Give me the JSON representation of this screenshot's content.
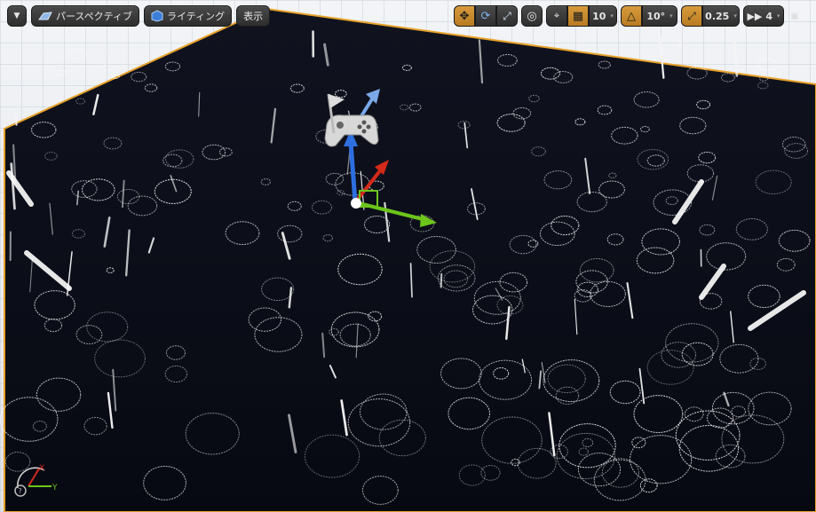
{
  "viewport": {
    "menu_icon": "chevron-down-icon",
    "perspective_label": "パースペクティブ",
    "perspective_icon": "perspective-icon",
    "lighting_label": "ライティング",
    "lighting_icon": "lighting-icon",
    "show_label": "表示"
  },
  "transform_tools": {
    "translate_icon": "translate-icon",
    "rotate_icon": "rotate-icon",
    "scale_icon": "scale-icon",
    "world_local_icon": "globe-icon",
    "surface_snap_icon": "surface-snap-icon",
    "grid_snap_icon": "grid-snap-icon",
    "grid_snap_value": "10",
    "rotation_snap_icon": "rotation-snap-icon",
    "rotation_snap_value": "10°",
    "scale_snap_icon": "scale-snap-icon",
    "scale_snap_value": "0.25",
    "camera_speed_icon": "camera-speed-icon",
    "camera_speed_value": "4",
    "maximize_icon": "maximize-icon"
  },
  "axis_labels": {
    "x": "X",
    "y": "Y"
  },
  "colors": {
    "selection_outline": "#e8a22a",
    "floor": "#0b0e1c",
    "active_button": "#c88a2e",
    "axis_x": "#d42a1a",
    "axis_y": "#6cc51a",
    "axis_z": "#2e6fe0"
  }
}
